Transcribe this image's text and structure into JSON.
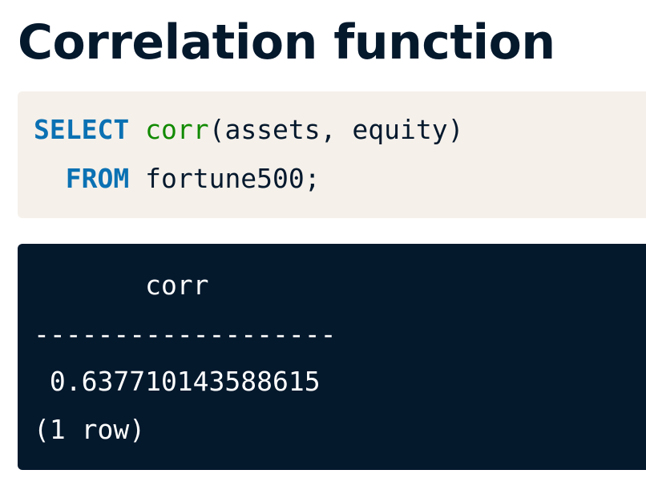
{
  "title": "Correlation function",
  "code": {
    "line1": {
      "keyword": "SELECT",
      "function": "corr",
      "rest": "(assets, equity)"
    },
    "line2": {
      "indent": "  ",
      "keyword": "FROM",
      "rest": " fortune500;"
    }
  },
  "output": {
    "header": "       corr",
    "separator": "-------------------",
    "value": " 0.637710143588615",
    "footer": "(1 row)"
  },
  "colors": {
    "keyword": "#0b71b3",
    "function": "#118a00",
    "text": "#05192d",
    "code_bg": "#f5f0ea",
    "output_bg": "#05192d"
  }
}
